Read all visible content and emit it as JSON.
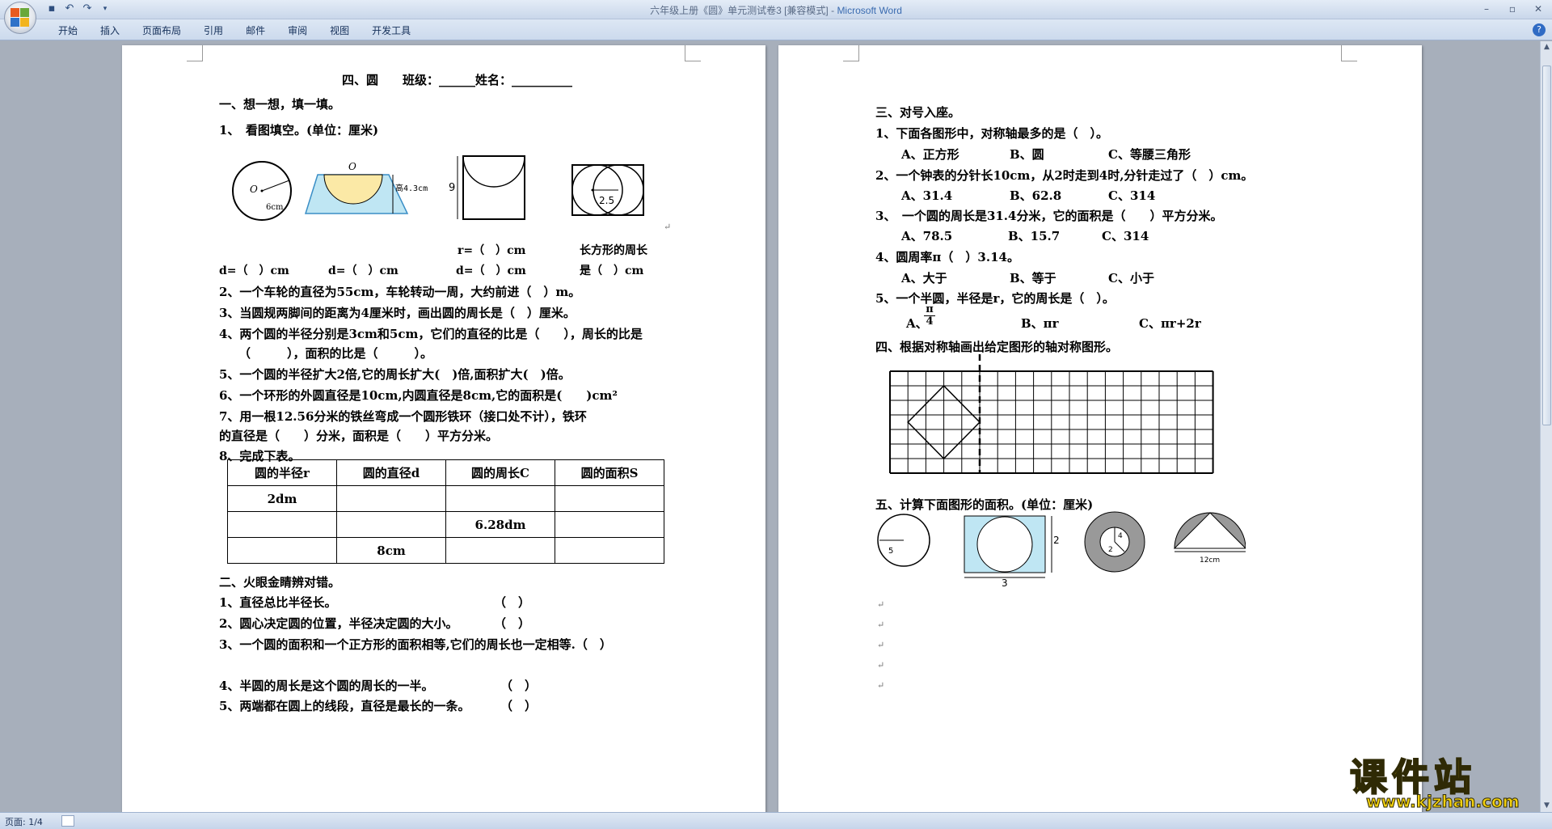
{
  "window": {
    "title": "六年级上册《圆》单元测试卷3 [兼容模式] - ",
    "app_name": "Microsoft Word"
  },
  "ribbon": {
    "tabs": [
      "开始",
      "插入",
      "页面布局",
      "引用",
      "邮件",
      "审阅",
      "视图",
      "开发工具"
    ]
  },
  "status": {
    "page": "页面: 1/4"
  },
  "watermark": {
    "main": "课件站",
    "url": "www.kjzhan.com"
  },
  "page1": {
    "heading": "四、圆　　班级：______姓名：__________",
    "s1_title": "一、想一想，填一填。",
    "q1": "1、　看图填空。(单位：厘米)",
    "fig_labels": {
      "o": "O",
      "six": "6cm",
      "o2": "O",
      "height": "高4.3cm",
      "nine": "9",
      "twofive": "2.5"
    },
    "r_line": "r=（　）cm",
    "rect_line1": "长方形的周长",
    "d1": "d=（　）cm",
    "d2": "d=（　）cm",
    "d3": "d=（　）cm",
    "rect_line2": "是（　）cm",
    "q2": "2、一个车轮的直径为55cm，车轮转动一周，大约前进（　）m。",
    "q3": "3、当圆规两脚间的距离为4厘米时，画出圆的周长是（　）厘米。",
    "q4a": "4、两个圆的半径分别是3cm和5cm，它们的直径的比是（　　），周长的比是",
    "q4b": "（　　　），面积的比是（　　　）。",
    "q5": "5、一个圆的半径扩大2倍,它的周长扩大(　)倍,面积扩大(　)倍。",
    "q6": "6、一个环形的外圆直径是10cm,内圆直径是8cm,它的面积是(　　)cm²",
    "q7a": "7、用一根12.56分米的铁丝弯成一个圆形铁环（接口处不计），铁环",
    "q7b": "的直径是（　　）分米，面积是（　　）平方分米。",
    "q8": "8、完成下表。",
    "table": {
      "header": [
        "圆的半径r",
        "圆的直径d",
        "圆的周长C",
        "圆的面积S"
      ],
      "rows": [
        [
          "2dm",
          "",
          "",
          ""
        ],
        [
          "",
          "",
          "6.28dm",
          ""
        ],
        [
          "",
          "8cm",
          "",
          ""
        ]
      ]
    },
    "s2_title": "二、火眼金睛辨对错。",
    "j1": "1、直径总比半径长。",
    "j2": "2、圆心决定圆的位置，半径决定圆的大小。",
    "j3": "3、一个圆的面积和一个正方形的面积相等,它们的周长也一定相等.（　）",
    "j4": "4、半圆的周长是这个圆的周长的一半。",
    "j5": "5、两端都在圆上的线段，直径是最长的一条。",
    "paren": "（　）"
  },
  "page2": {
    "s3_title": "三、对号入座。",
    "c1": "1、下面各图形中，对称轴最多的是（　）。",
    "c1_opts": [
      "A、正方形",
      "B、圆",
      "C、等腰三角形"
    ],
    "c2": "2、一个钟表的分针长10cm，从2时走到4时,分针走过了（　）cm。",
    "c2_opts": [
      "A、31.4",
      "B、62.8",
      "C、314"
    ],
    "c3": "3、　一个圆的周长是31.4分米，它的面积是（　　）平方分米。",
    "c3_opts": [
      "A、78.5",
      "B、15.7",
      "C、314"
    ],
    "c4": "4、圆周率π（　）3.14。",
    "c4_opts": [
      "A、大于",
      "B、等于",
      "C、小于"
    ],
    "c5": "5、一个半圆，半径是r，它的周长是（　）。",
    "c5_opts": [
      "A、",
      "B、πr",
      "C、πr+2r"
    ],
    "c5_frac": {
      "num": "π",
      "den": "4"
    },
    "s4_title": "四、根据对称轴画出给定图形的轴对称图形。",
    "s5_title": "五、计算下面图形的面积。(单位：厘米)",
    "area_labels": {
      "five": "5",
      "two": "2",
      "three": "3",
      "four": "4",
      "two_b": "2",
      "twelve": "12cm"
    }
  }
}
